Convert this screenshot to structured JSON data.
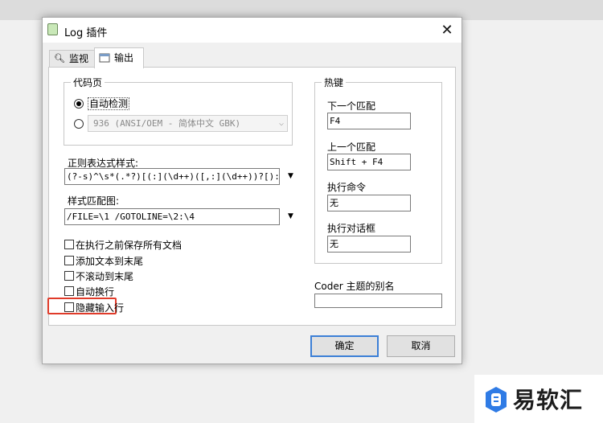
{
  "window": {
    "title": "Log 插件",
    "close_glyph": "✕"
  },
  "tabs": [
    {
      "label": "监视",
      "icon": "magnifier-icon"
    },
    {
      "label": "输出",
      "icon": "output-window-icon"
    }
  ],
  "codepage": {
    "group_title": "代码页",
    "auto_detect_label": "自动检测",
    "auto_detect_selected": true,
    "manual_value": "936  (ANSI/OEM - 简体中文 GBK)"
  },
  "regex": {
    "label": "正则表达式样式:",
    "value": "(?-s)^\\s*(.*?)[(:](\\d++)([,:](\\d++))?[):]"
  },
  "style_map": {
    "label": "样式匹配图:",
    "value": "/FILE=\\1 /GOTOLINE=\\2:\\4"
  },
  "checkboxes": [
    {
      "label": "在执行之前保存所有文档",
      "checked": false
    },
    {
      "label": "添加文本到末尾",
      "checked": false
    },
    {
      "label": "不滚动到末尾",
      "checked": false
    },
    {
      "label": "自动换行",
      "checked": false
    },
    {
      "label": "隐藏输入行",
      "checked": false
    }
  ],
  "hotkeys": {
    "group_title": "热键",
    "items": [
      {
        "label": "下一个匹配",
        "value": "F4"
      },
      {
        "label": "上一个匹配",
        "value": "Shift + F4"
      },
      {
        "label": "执行命令",
        "value": "无"
      },
      {
        "label": "执行对话框",
        "value": "无"
      }
    ]
  },
  "coder_alias": {
    "label": "Coder 主题的别名",
    "value": ""
  },
  "buttons": {
    "ok": "确定",
    "cancel": "取消"
  },
  "watermark": {
    "text": "易软汇"
  },
  "colors": {
    "highlight": "#e03b2a",
    "default_button_border": "#3c7fd6"
  }
}
